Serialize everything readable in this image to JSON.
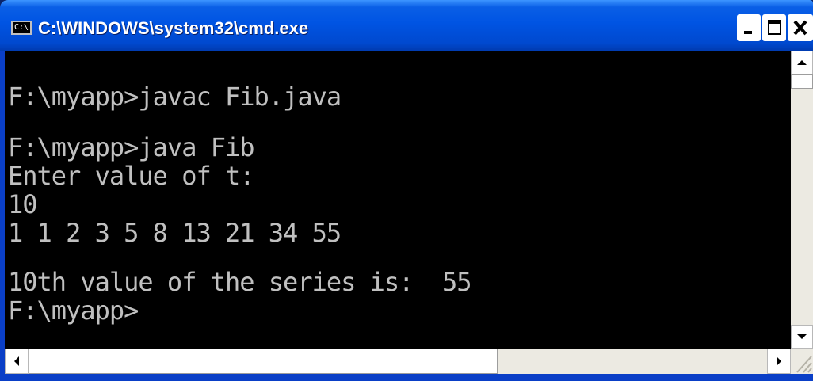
{
  "window": {
    "title": "C:\\WINDOWS\\system32\\cmd.exe",
    "icon": "cmd-icon",
    "icon_label": "C:\\"
  },
  "controls": {
    "minimize_icon": "minimize-icon",
    "restore_icon": "restore-icon",
    "close_icon": "close-icon"
  },
  "console": {
    "lines": [
      "",
      "F:\\myapp>javac Fib.java",
      "",
      "F:\\myapp>java Fib",
      "Enter value of t:",
      "10",
      "1 1 2 3 5 8 13 21 34 55",
      "",
      "10th value of the series is:  55",
      "F:\\myapp>"
    ]
  },
  "colors": {
    "console_bg": "#000000",
    "console_fg": "#c0c0c0",
    "titlebar": "#0054e3"
  }
}
